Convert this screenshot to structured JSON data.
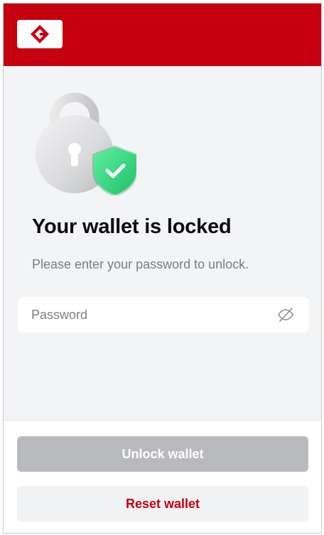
{
  "header": {
    "logo_icon": "brand-logo-icon",
    "background_color": "#c5000f"
  },
  "hero": {
    "lock_icon": "padlock-icon",
    "shield_icon": "shield-check-icon"
  },
  "main": {
    "title": "Your wallet is locked",
    "subtitle": "Please enter your password to unlock."
  },
  "password": {
    "placeholder": "Password",
    "value": "",
    "toggle_icon": "eye-off-icon"
  },
  "footer": {
    "unlock_label": "Unlock wallet",
    "reset_label": "Reset wallet"
  },
  "colors": {
    "brand": "#c5000f",
    "shield": "#2fd27a",
    "disabled_button": "#b9babe"
  }
}
